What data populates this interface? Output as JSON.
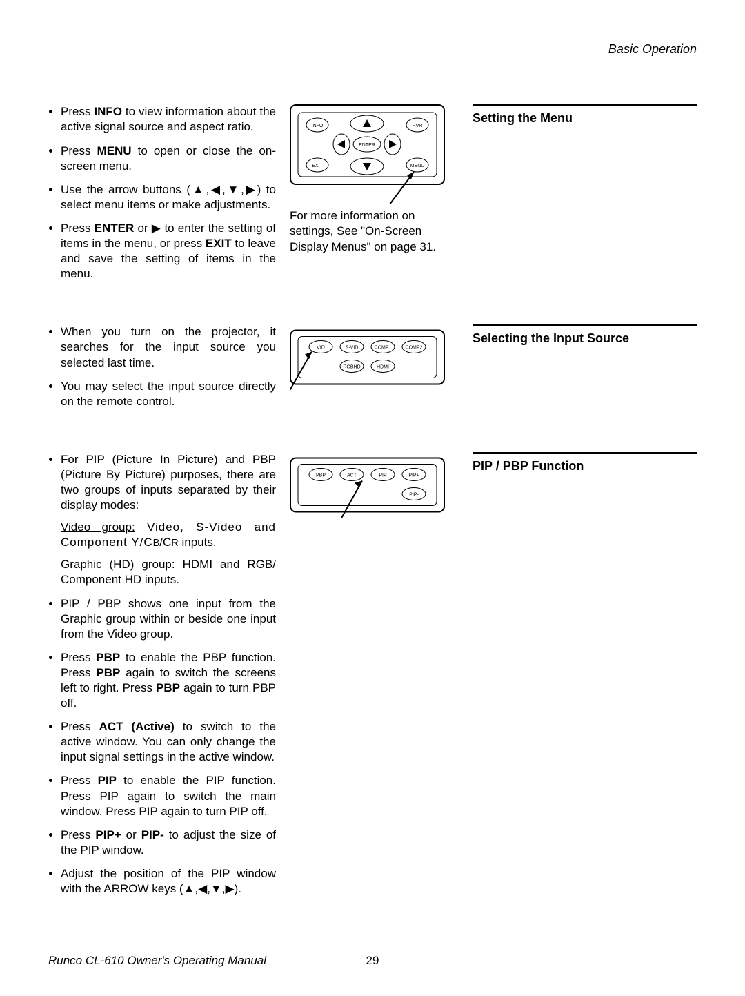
{
  "header": {
    "title": "Basic Operation"
  },
  "section1": {
    "heading": "Setting the Menu",
    "bullets": [
      {
        "pre": "Press ",
        "b": "INFO",
        "post": " to view information about the active signal source and aspect ratio."
      },
      {
        "pre": "Press ",
        "b": "MENU",
        "post": " to open or close the on-screen menu."
      },
      {
        "pre": "Use the arrow buttons (▲,◀,▼,▶) to select menu items or make adjustments.",
        "b": "",
        "post": ""
      },
      {
        "pre": "Press ",
        "b": "ENTER",
        "mid": " or ▶ to enter the setting of items in the menu, or press ",
        "b2": "EXIT",
        "post": " to leave and save the setting of items in the menu."
      }
    ],
    "diagram": {
      "buttons": {
        "info": "INFO",
        "rvr": "RVR",
        "enter": "ENTER",
        "exit": "EXIT",
        "menu": "MENU"
      },
      "caption": "For more information on settings, See \"On-Screen Display Menus\" on page 31."
    }
  },
  "section2": {
    "heading": "Selecting the Input Source",
    "bullets": [
      "When you turn on the projector, it searches for the input source you selected last time.",
      "You may select the input source directly on the remote control."
    ],
    "diagram": {
      "buttons": [
        "VID",
        "S-VID",
        "COMP1",
        "COMP2",
        "RGBHD",
        "HDMI"
      ]
    }
  },
  "section3": {
    "heading": "PIP / PBP Function",
    "bullet1": "For PIP (Picture In Picture) and PBP (Picture By Picture) purposes, there are two groups of inputs separated by their display modes:",
    "video_group_label": "Video group:",
    "video_group_text": " Video, S-Video and Component Y/C",
    "video_group_sub1": "B",
    "video_group_mid": "/C",
    "video_group_sub2": "R",
    "video_group_end": " inputs.",
    "graphic_group_label": "Graphic (HD) group:",
    "graphic_group_text": " HDMI and RGB/ Component HD inputs.",
    "bullet2": "PIP / PBP shows one input from the Graphic group within or beside one input from the Video group.",
    "bullet3": {
      "pre": "Press ",
      "b": "PBP",
      "mid1": " to enable the PBP function. Press ",
      "b2": "PBP",
      "mid2": " again to switch the screens left to right. Press ",
      "b3": "PBP",
      "post": " again to turn PBP off."
    },
    "bullet4": {
      "pre": "Press ",
      "b": "ACT (Active)",
      "post": " to switch to the active window. You can only change the input signal settings in the active window."
    },
    "bullet5": {
      "pre": "Press ",
      "b": "PIP",
      "post": " to enable the PIP function. Press PIP again to switch the main window. Press PIP again to turn PIP off."
    },
    "bullet6": {
      "pre": "Press ",
      "b": "PIP+",
      "mid": " or ",
      "b2": "PIP-",
      "post": " to adjust the size of the PIP window."
    },
    "bullet7": "Adjust the position of the PIP window with the ARROW keys (▲,◀,▼,▶).",
    "diagram": {
      "buttons": [
        "PBP",
        "ACT",
        "PIP",
        "PIP+",
        "PIP-"
      ]
    }
  },
  "footer": {
    "left": "Runco CL-610 Owner's Operating Manual",
    "page": "29"
  }
}
